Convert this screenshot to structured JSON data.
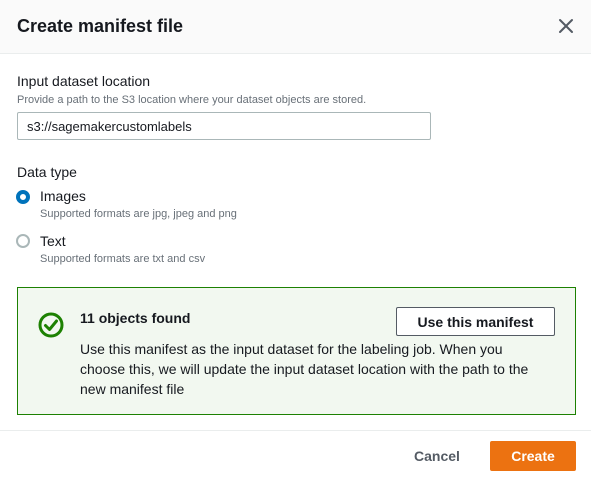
{
  "modal": {
    "title": "Create manifest file",
    "close_icon": "close-icon"
  },
  "input_location": {
    "label": "Input dataset location",
    "description": "Provide a path to the S3 location where your dataset objects are stored.",
    "value": "s3://sagemakercustomlabels"
  },
  "data_type": {
    "label": "Data type",
    "options": [
      {
        "label": "Images",
        "description": "Supported formats are jpg, jpeg and png",
        "selected": true
      },
      {
        "label": "Text",
        "description": "Supported formats are txt and csv",
        "selected": false
      }
    ]
  },
  "alert": {
    "type": "success",
    "icon": "check-circle-icon",
    "title": "11 objects found",
    "body": "Use this manifest as the input dataset for the labeling job. When you choose this, we will update the input dataset location with the path to the new manifest file",
    "button_label": "Use this manifest"
  },
  "footer": {
    "cancel_label": "Cancel",
    "create_label": "Create"
  },
  "colors": {
    "primary_button": "#ec7211",
    "radio_selected": "#0073bb",
    "success_border": "#1d8102",
    "success_background": "#f2f8f0"
  }
}
